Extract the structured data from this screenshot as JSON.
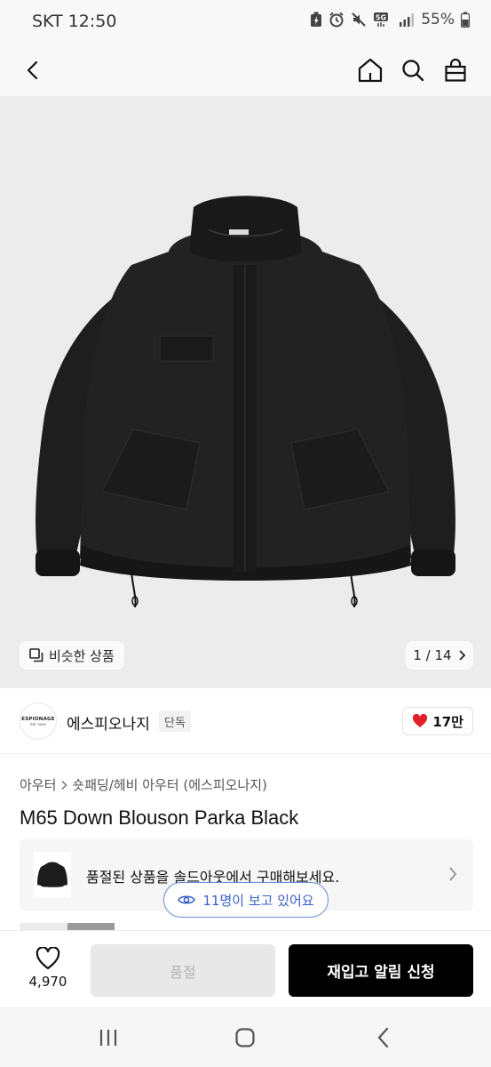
{
  "status_bar": {
    "carrier_time": "SKT 12:50",
    "network": "5G",
    "battery": "55%"
  },
  "hero": {
    "similar_label": "비슷한 상품",
    "pager": "1 / 14"
  },
  "brand": {
    "logo_line1": "ESPIONAGE",
    "logo_line2": "EST. 2010",
    "name": "에스피오나지",
    "badge": "단독",
    "likes": "17만"
  },
  "breadcrumb": {
    "level1": "아우터",
    "level2": "숏패딩/헤비 아우터 (에스피오나지)"
  },
  "product": {
    "title": "M65 Down Blouson Parka Black"
  },
  "soldout_notice": {
    "text": "품절된 상품을 솔드아웃에서 구매해보세요."
  },
  "viewers": {
    "text": "11명이 보고 있어요"
  },
  "bottom_bar": {
    "heart_count": "4,970",
    "soldout_label": "품절",
    "restock_label": "재입고 알림 신청"
  },
  "colors": {
    "accent_blue": "#3a5fc7",
    "like_red": "#e0202a",
    "primary_black": "#000000"
  }
}
